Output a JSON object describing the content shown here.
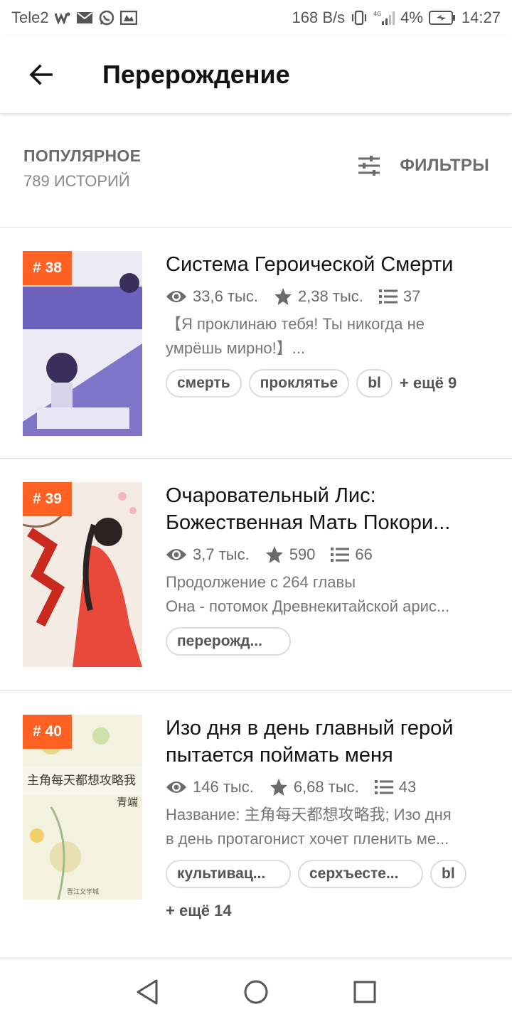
{
  "status_bar": {
    "carrier": "Tele2",
    "speed": "168 B/s",
    "battery": "4%",
    "time": "14:27",
    "icons": [
      "wifi-calling-icon",
      "mail-icon",
      "whatsapp-icon",
      "gallery-icon",
      "vibrate-icon",
      "signal-4g-icon",
      "battery-icon"
    ]
  },
  "app_bar": {
    "title": "Перерождение",
    "back_icon": "arrow-left-icon"
  },
  "header": {
    "sort_label": "ПОПУЛЯРНОЕ",
    "count": "789 ИСТОРИЙ",
    "filters_label": "ФИЛЬТРЫ",
    "filters_icon": "sliders-icon"
  },
  "stories": [
    {
      "rank": "# 38",
      "title": "Система Героической Смерти",
      "views": "33,6 тыс.",
      "votes": "2,38 тыс.",
      "parts": "37",
      "desc": [
        "【Я проклинаю тебя! Ты никогда не",
        "умрёшь мирно!】..."
      ],
      "tags": [
        "смерть",
        "проклятье",
        "bl"
      ],
      "more": "+ ещё 9",
      "cover_colors": [
        "#7f74c8",
        "#e6e6f2"
      ]
    },
    {
      "rank": "# 39",
      "title": " Очаровательный Лис: Божественная Мать Покори...",
      "title_lines": [
        " Очаровательный Лис:",
        "Божественная Мать Покори..."
      ],
      "views": "3,7 тыс.",
      "votes": "590",
      "parts": "66",
      "desc": [
        "Продолжение с 264 главы",
        "Она - потомок Древнекитайской арис..."
      ],
      "tags": [
        "перерожд..."
      ],
      "more": "",
      "cover_colors": [
        "#f0e4d8",
        "#e8493a"
      ]
    },
    {
      "rank": "# 40",
      "title_lines": [
        "Изо дня в день главный герой",
        "пытается поймать меня"
      ],
      "views": "146 тыс.",
      "votes": "6,68 тыс.",
      "parts": "43",
      "desc": [
        "Название: 主角每天都想攻略我; Изо дня",
        "в день протагонист хочет пленить ме..."
      ],
      "tags": [
        "культивац...",
        "серхъесте...",
        "bl"
      ],
      "more": "+ ещё 14",
      "cover_colors": [
        "#f3f0d6",
        "#d9d6a8"
      ]
    }
  ],
  "nav_bar": {
    "icons": [
      "back-triangle-icon",
      "home-circle-icon",
      "recents-square-icon"
    ]
  }
}
